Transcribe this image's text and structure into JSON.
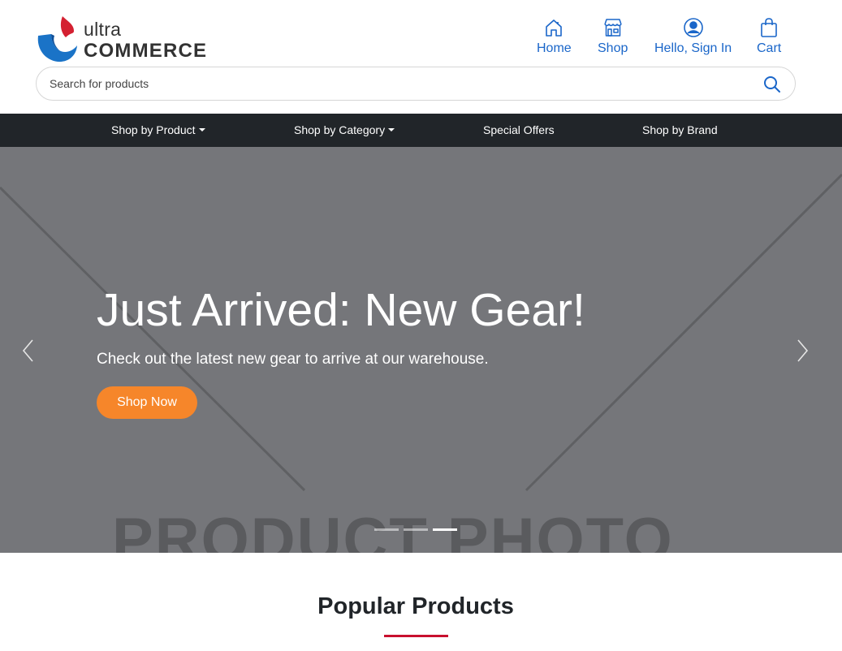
{
  "brand": {
    "line1": "ultra",
    "line2": "COMMERCE",
    "colors": {
      "red": "#d42031",
      "blue": "#1a73c7"
    }
  },
  "header_nav": [
    {
      "label": "Home",
      "icon": "house-icon"
    },
    {
      "label": "Shop",
      "icon": "storefront-icon"
    },
    {
      "label": "Hello, Sign In",
      "icon": "user-circle-icon"
    },
    {
      "label": "Cart",
      "icon": "shopping-bag-icon"
    }
  ],
  "search": {
    "placeholder": "Search for products",
    "value": "",
    "icon": "search-icon"
  },
  "category_nav": [
    {
      "label": "Shop by Product",
      "dropdown": true
    },
    {
      "label": "Shop by Category",
      "dropdown": true
    },
    {
      "label": "Special Offers",
      "dropdown": false
    },
    {
      "label": "Shop by Brand",
      "dropdown": false
    }
  ],
  "hero": {
    "title": "Just Arrived: New Gear!",
    "subtitle": "Check out the latest new gear to arrive at our warehouse.",
    "button_label": "Shop Now",
    "background_text": "PRODUCT PHOTO",
    "slides": 3,
    "active_slide": 3,
    "prev_icon": "chevron-left-icon",
    "next_icon": "chevron-right-icon"
  },
  "popular": {
    "title": "Popular Products"
  },
  "colors": {
    "accent": "#f6862a",
    "link": "#1a66c9",
    "navbar": "#212529",
    "underline": "#c8102e",
    "hero_bg": "#75767a"
  }
}
